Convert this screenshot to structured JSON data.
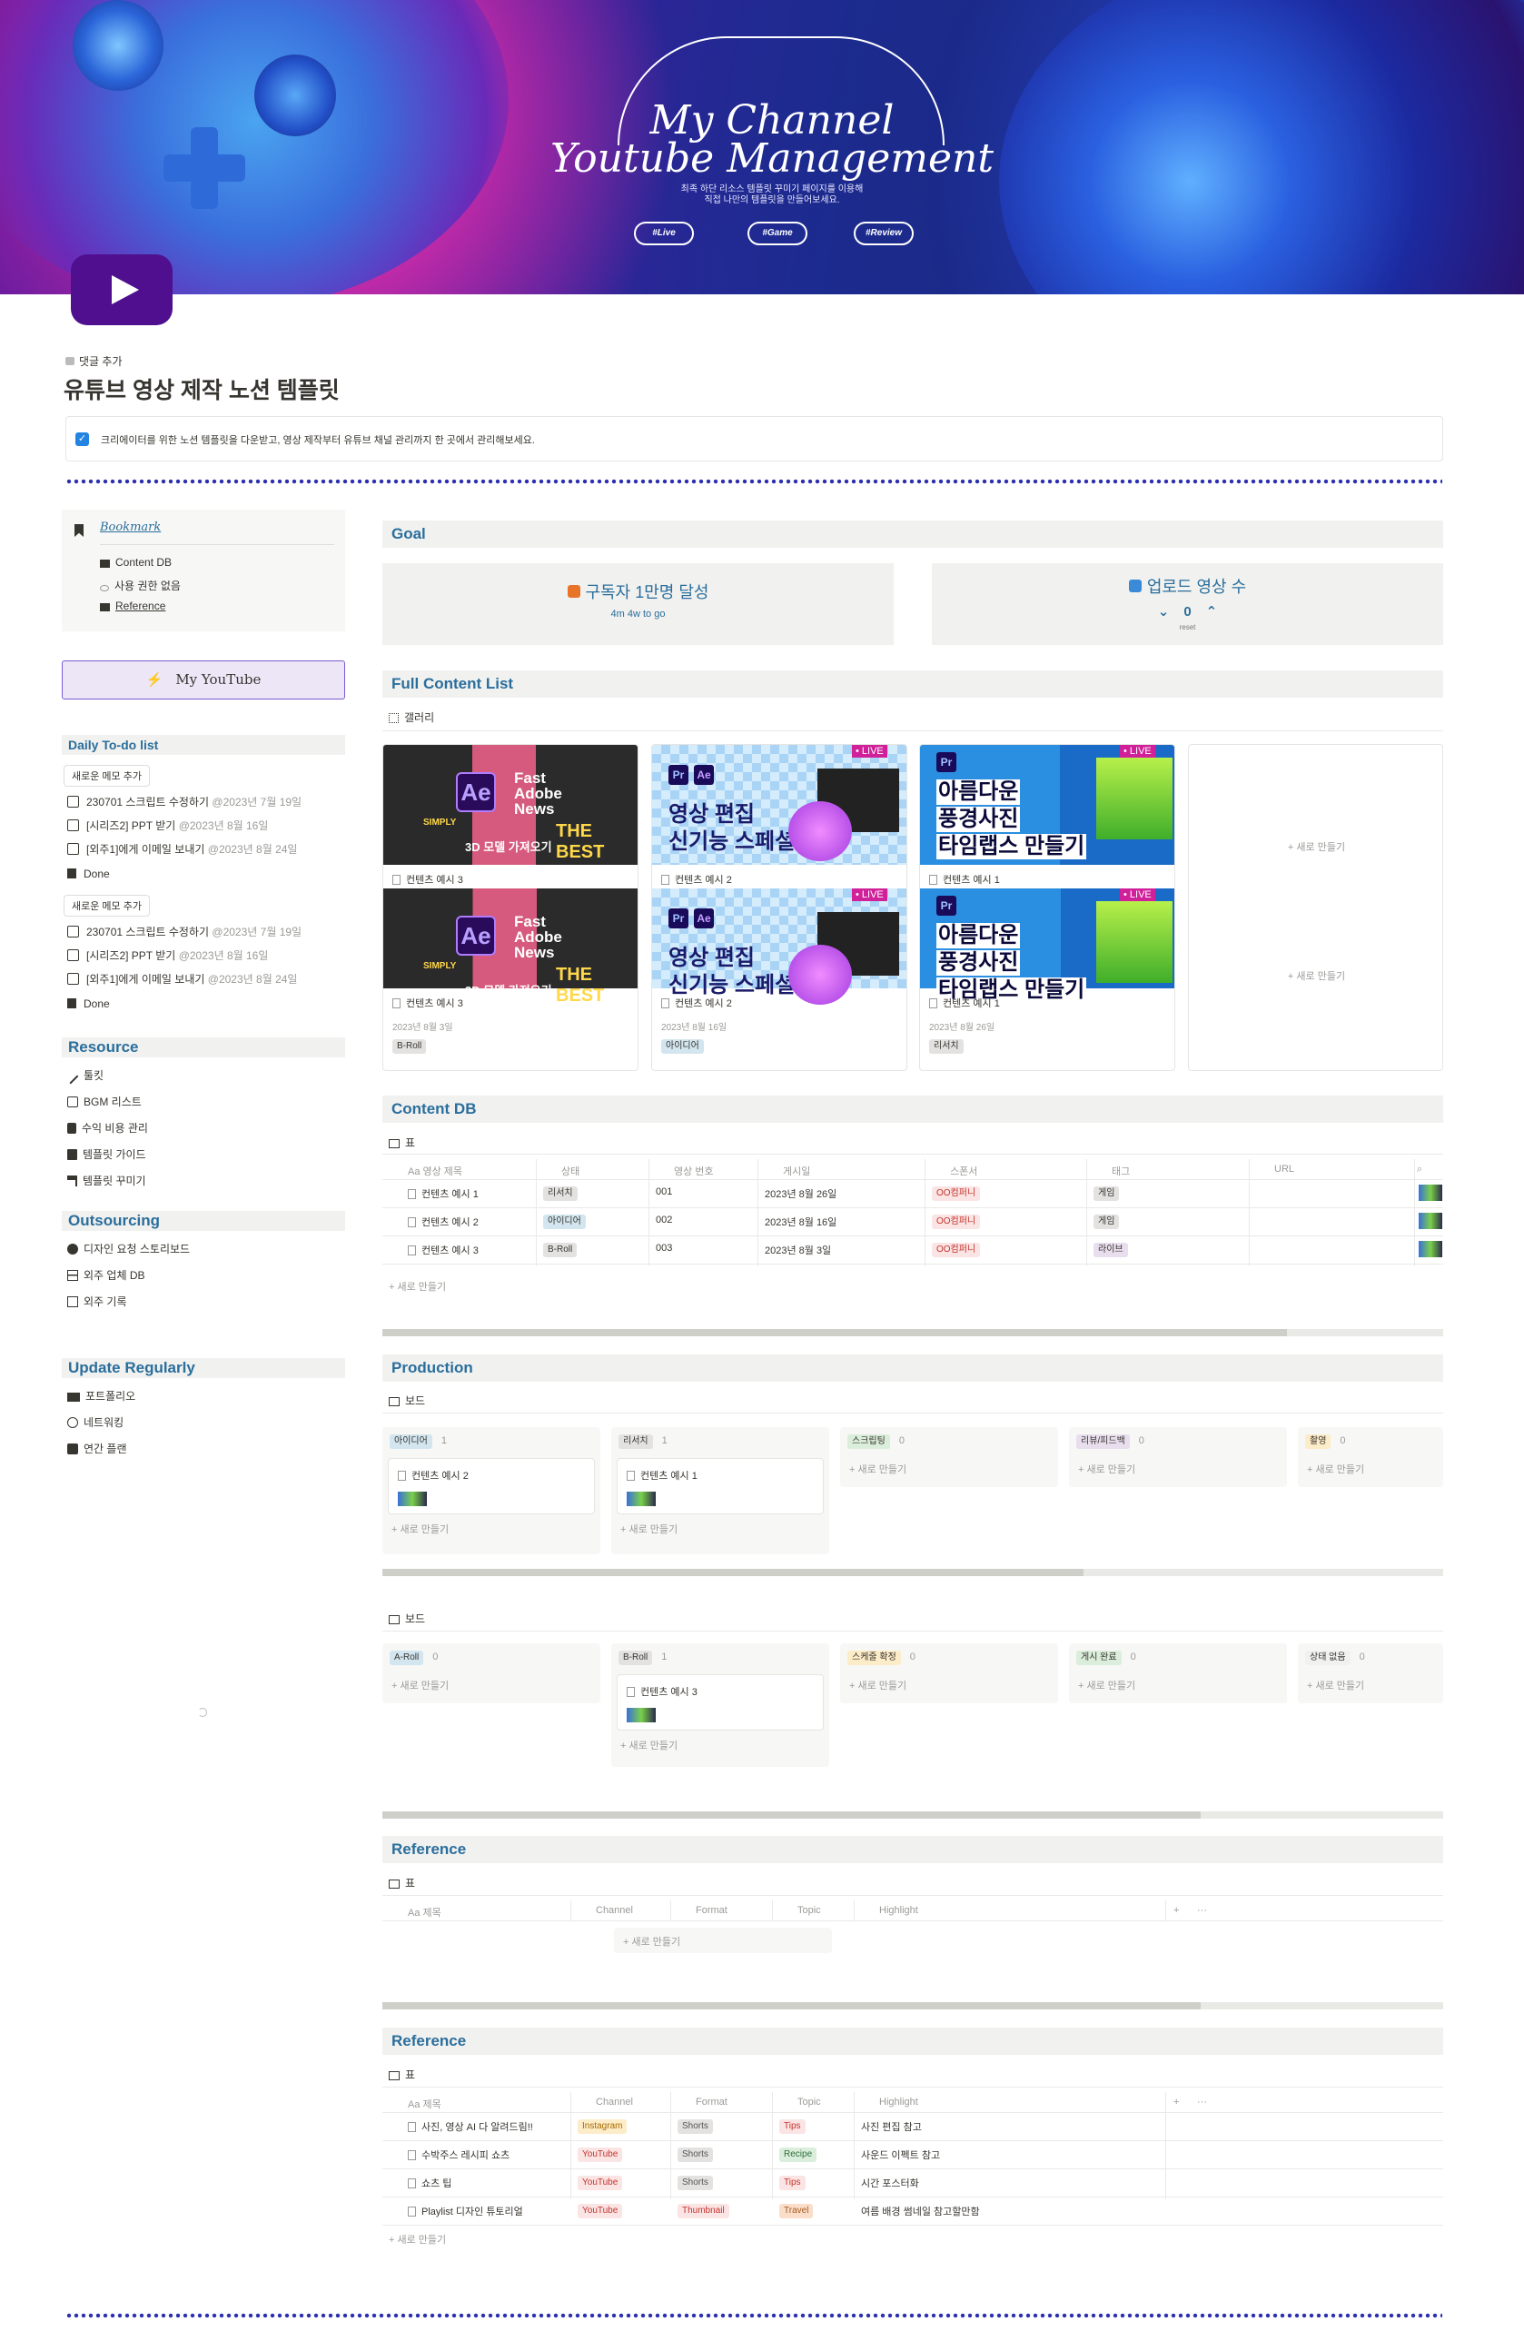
{
  "cover": {
    "title_line1": "My Channel",
    "title_line2": "Youtube Management",
    "subtitle_line1": "최족 하단 리소스 템플릿 꾸미기 페이지를 이용해",
    "subtitle_line2": "직접 나만의 템플릿을 만들어보세요.",
    "pills": [
      "#Live",
      "#Game",
      "#Review"
    ]
  },
  "page": {
    "add_comment": "댓글 추가",
    "title": "유튜브 영상 제작 노션 템플릿",
    "callout": "크리에이터를 위한 노션 템플릿을 다운받고, 영상 제작부터 유튜브 채널 관리까지 한 곳에서 관리해보세요."
  },
  "sidebar": {
    "bookmark_title": "Bookmark",
    "bookmarks": [
      "Content DB",
      "사용 권한 없음",
      "Reference"
    ],
    "my_youtube": "My YouTube",
    "todo_title": "Daily To-do list",
    "todo_groups": [
      {
        "button": "새로운 메모 추가",
        "items": [
          {
            "text": "230701 스크립트 수정하기",
            "date": "@2023년 7월 19일"
          },
          {
            "text": "[시리즈2] PPT 받기",
            "date": "@2023년 8월 16일"
          },
          {
            "text": "[외주1]에게 이메일 보내기",
            "date": "@2023년 8월 24일"
          }
        ],
        "done": "Done"
      },
      {
        "button": "새로운 메모 추가",
        "items": [
          {
            "text": "230701 스크립트 수정하기",
            "date": "@2023년 7월 19일"
          },
          {
            "text": "[시리즈2] PPT 받기",
            "date": "@2023년 8월 16일"
          },
          {
            "text": "[외주1]에게 이메일 보내기",
            "date": "@2023년 8월 24일"
          }
        ],
        "done": "Done"
      }
    ],
    "resource_title": "Resource",
    "resources": [
      "툴킷",
      "BGM 리스트",
      "수익 비용 관리",
      "템플릿 가이드",
      "템플릿 꾸미기"
    ],
    "outsourcing_title": "Outsourcing",
    "outsourcing": [
      "디자인 요청 스토리보드",
      "외주 업체 DB",
      "외주 기록"
    ],
    "update_title": "Update Regularly",
    "update": [
      "포트폴리오",
      "네트워킹",
      "연간 플랜"
    ]
  },
  "goal": {
    "title": "Goal",
    "card1_title": "구독자 1만명 달성",
    "card1_sub": "4m 4w to go",
    "card2_title": "업로드 영상 수",
    "card2_value": "0",
    "card2_reset": "reset"
  },
  "full_list": {
    "title": "Full Content List",
    "view": "갤러리",
    "new": "+ 새로 만들기",
    "row1": [
      {
        "name": "컨텐츠 예시 3"
      },
      {
        "name": "컨텐츠 예시 2"
      },
      {
        "name": "컨텐츠 예시 1"
      }
    ],
    "row2": [
      {
        "name": "컨텐츠 예시 3",
        "date": "2023년 8월 3일",
        "tag": "B-Roll"
      },
      {
        "name": "컨텐츠 예시 2",
        "date": "2023년 8월 16일",
        "tag": "아이디어"
      },
      {
        "name": "컨텐츠 예시 1",
        "date": "2023년 8월 26일",
        "tag": "리서치"
      }
    ],
    "thumb_texts": {
      "ae_lines": [
        "Fast",
        "Adobe",
        "News"
      ],
      "simply": "SIMPLY",
      "best": "THE BEST",
      "ae_caption": "3D 모델 가져오기",
      "edit_lines": [
        "영상 편집",
        "신기능 스페셜"
      ],
      "live": "• LIVE",
      "photo_lines": [
        "아름다운",
        "풍경사진",
        "타임랩스 만들기"
      ]
    }
  },
  "content_db": {
    "title": "Content DB",
    "view": "표",
    "headers": [
      "Aa 영상 제목",
      "상태",
      "영상 번호",
      "게시일",
      "스폰서",
      "태그",
      "URL"
    ],
    "rows": [
      {
        "name": "컨텐츠 예시 1",
        "status": "리서치",
        "num": "001",
        "date": "2023년 8월 26일",
        "sponsor": "OO컴퍼니",
        "tag": "게임"
      },
      {
        "name": "컨텐츠 예시 2",
        "status": "아이디어",
        "num": "002",
        "date": "2023년 8월 16일",
        "sponsor": "OO컴퍼니",
        "tag": "게임"
      },
      {
        "name": "컨텐츠 예시 3",
        "status": "B-Roll",
        "num": "003",
        "date": "2023년 8월 3일",
        "sponsor": "OO컴퍼니",
        "tag": "라이브"
      }
    ],
    "new": "+ 새로 만들기"
  },
  "production": {
    "title": "Production",
    "view": "보드",
    "new": "+ 새로 만들기",
    "board1": [
      {
        "label": "아이디어",
        "count": "1",
        "card": "컨텐츠 예시 2"
      },
      {
        "label": "리서치",
        "count": "1",
        "card": "컨텐츠 예시 1"
      },
      {
        "label": "스크립팅",
        "count": "0"
      },
      {
        "label": "리뷰/피드백",
        "count": "0"
      },
      {
        "label": "촬영",
        "count": "0"
      }
    ],
    "board2": [
      {
        "label": "A-Roll",
        "count": "0"
      },
      {
        "label": "B-Roll",
        "count": "1",
        "card": "컨텐츠 예시 3"
      },
      {
        "label": "스케줄 확정",
        "count": "0"
      },
      {
        "label": "게시 완료",
        "count": "0"
      },
      {
        "label": "상태 없음",
        "count": "0"
      }
    ]
  },
  "reference1": {
    "title": "Reference",
    "view": "표",
    "headers": [
      "Aa 제목",
      "Channel",
      "Format",
      "Topic",
      "Highlight"
    ],
    "new": "+ 새로 만들기"
  },
  "reference2": {
    "title": "Reference",
    "view": "표",
    "headers": [
      "Aa 제목",
      "Channel",
      "Format",
      "Topic",
      "Highlight"
    ],
    "rows": [
      {
        "name": "사진, 영상 AI 다 알려드림!!",
        "channel": "Instagram",
        "format": "Shorts",
        "topic": "Tips",
        "highlight": "사진 편집 참고"
      },
      {
        "name": "수박주스 레시피 쇼츠",
        "channel": "YouTube",
        "format": "Shorts",
        "topic": "Recipe",
        "highlight": "사운드 이펙트 참고"
      },
      {
        "name": "쇼츠 팁",
        "channel": "YouTube",
        "format": "Shorts",
        "topic": "Tips",
        "highlight": "시간 포스터화"
      },
      {
        "name": "Playlist 디자인 튜토리얼",
        "channel": "YouTube",
        "format": "Thumbnail",
        "topic": "Travel",
        "highlight": "여름 배경 썸네일 참고할만함"
      }
    ],
    "new": "+ 새로 만들기"
  },
  "colors": {
    "accent": "#2a6e9c",
    "dots": "#2b2fb0",
    "yt": "#4f0f8f"
  }
}
